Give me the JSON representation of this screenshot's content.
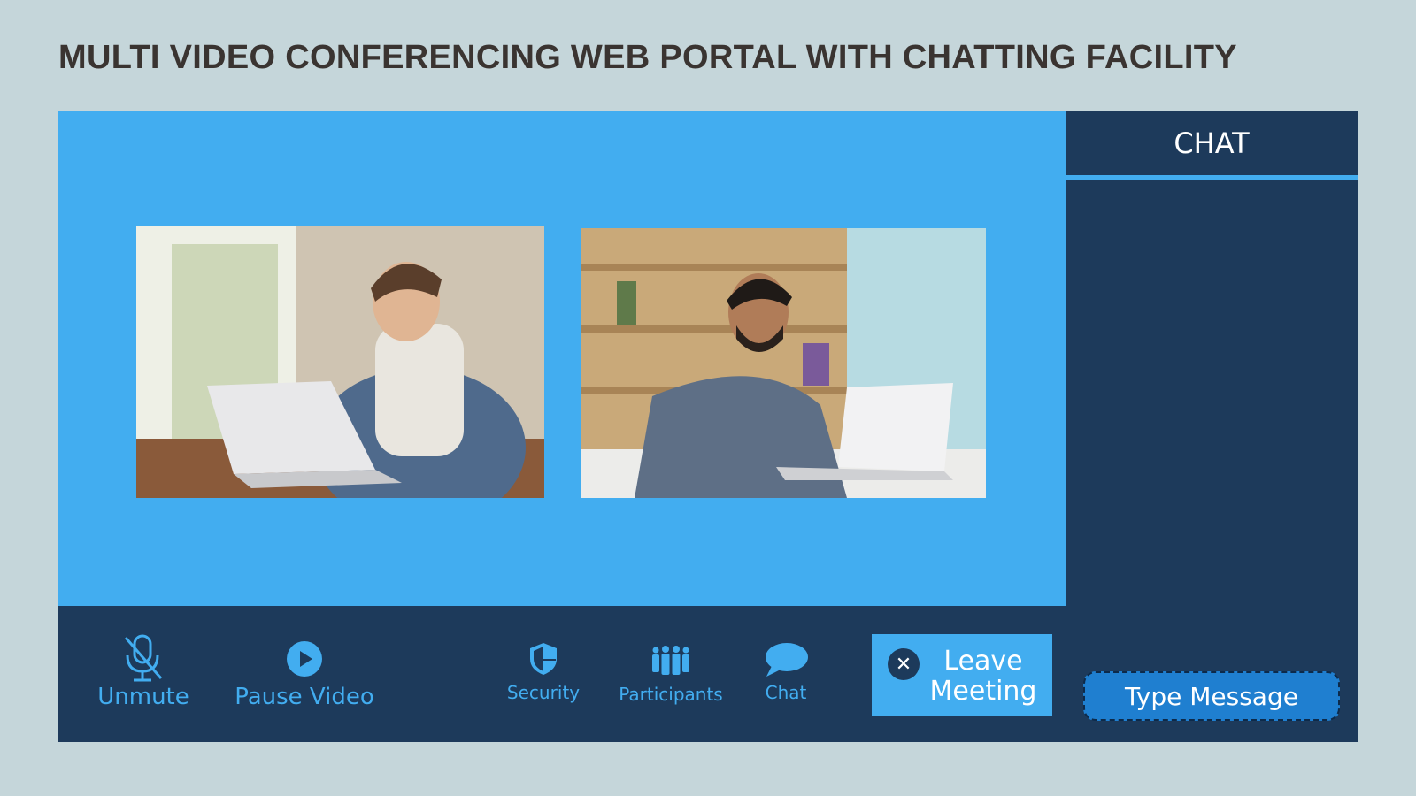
{
  "page": {
    "title": "MULTI VIDEO CONFERENCING WEB PORTAL WITH CHATTING FACILITY"
  },
  "colors": {
    "background": "#c5d6da",
    "stage": "#42adf0",
    "dark_panel": "#1d3a5b",
    "accent": "#42adf0",
    "input": "#1f7fd0"
  },
  "video": {
    "tiles": [
      {
        "name": "participant-1",
        "description_icon": "person-with-laptop"
      },
      {
        "name": "participant-2",
        "description_icon": "person-with-laptop"
      }
    ]
  },
  "controls": {
    "unmute": {
      "label": "Unmute",
      "icon": "muted-microphone-icon"
    },
    "pause_video": {
      "label": "Pause Video",
      "icon": "play-circle-icon"
    },
    "security": {
      "label": "Security",
      "icon": "shield-icon"
    },
    "participants": {
      "label": "Participants",
      "icon": "people-icon"
    },
    "chat": {
      "label": "Chat",
      "icon": "speech-bubble-icon"
    },
    "leave": {
      "label": "Leave Meeting",
      "icon": "close-icon"
    }
  },
  "chat": {
    "title": "CHAT",
    "input_placeholder": "Type Message"
  }
}
